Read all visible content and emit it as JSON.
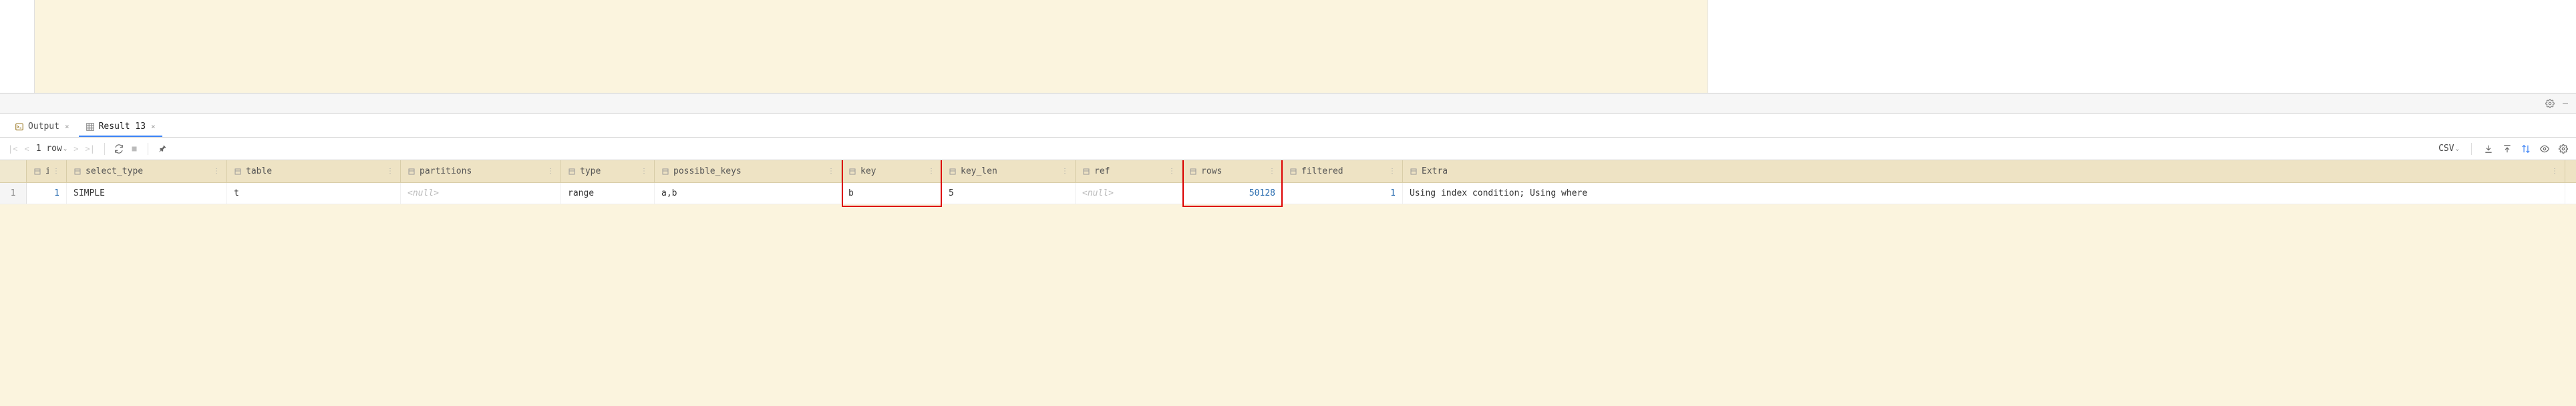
{
  "tabs": {
    "output": "Output",
    "result": "Result 13"
  },
  "toolbar": {
    "row_count": "1 row",
    "csv": "CSV"
  },
  "headers": {
    "id": "id",
    "select_type": "select_type",
    "table": "table",
    "partitions": "partitions",
    "type": "type",
    "possible_keys": "possible_keys",
    "key": "key",
    "key_len": "key_len",
    "ref": "ref",
    "rows": "rows",
    "filtered": "filtered",
    "Extra": "Extra"
  },
  "row": {
    "num": "1",
    "id": "1",
    "select_type": "SIMPLE",
    "table": "t",
    "partitions": "<null>",
    "type": "range",
    "possible_keys": "a,b",
    "key": "b",
    "key_len": "5",
    "ref": "<null>",
    "rows": "50128",
    "filtered": "1",
    "Extra": "Using index condition; Using where"
  },
  "chart_data": {
    "type": "table",
    "title": "Result 13",
    "columns": [
      "id",
      "select_type",
      "table",
      "partitions",
      "type",
      "possible_keys",
      "key",
      "key_len",
      "ref",
      "rows",
      "filtered",
      "Extra"
    ],
    "rows": [
      {
        "id": 1,
        "select_type": "SIMPLE",
        "table": "t",
        "partitions": null,
        "type": "range",
        "possible_keys": "a,b",
        "key": "b",
        "key_len": 5,
        "ref": null,
        "rows": 50128,
        "filtered": 1,
        "Extra": "Using index condition; Using where"
      }
    ]
  }
}
